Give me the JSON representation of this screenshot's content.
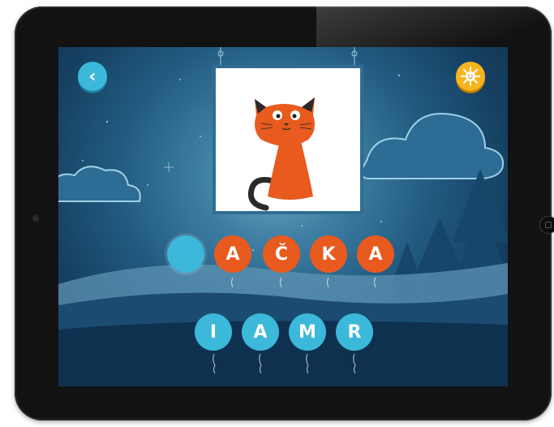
{
  "screen": {
    "back_button_icon": "chevron-left-icon",
    "settings_button_icon": "sun-icon",
    "picture_icon": "cat-icon",
    "back_glyph": "‹"
  },
  "answer_slots": [
    {
      "letter": "",
      "state": "empty"
    },
    {
      "letter": "A",
      "state": "filled"
    },
    {
      "letter": "Č",
      "state": "filled"
    },
    {
      "letter": "K",
      "state": "filled"
    },
    {
      "letter": "A",
      "state": "filled"
    }
  ],
  "letter_choices": [
    {
      "letter": "I"
    },
    {
      "letter": "A"
    },
    {
      "letter": "M"
    },
    {
      "letter": "R"
    }
  ],
  "colors": {
    "orange_balloon": "#e85a1e",
    "blue_balloon": "#3bb8da",
    "sun": "#f6b51f",
    "sky_dark": "#0f2f4b",
    "sky_light": "#6fa9c4"
  }
}
